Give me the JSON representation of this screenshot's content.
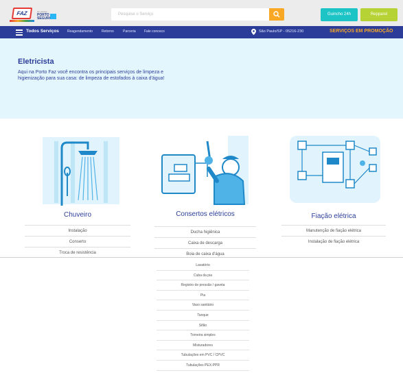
{
  "header": {
    "logo_text": "FAZ",
    "partner_small": "um serviço",
    "partner_name": "PORTO SEGURO",
    "search_placeholder": "Pesquise o Serviço",
    "btn_quincho": "Guincho 24h",
    "btn_rappel": "Repparel"
  },
  "nav": {
    "all_services": "Todos Serviços",
    "links": [
      "Reagendamento",
      "Retorno",
      "Parceria",
      "Fale conosco"
    ],
    "location": "São Paulo/SP - 05216-230",
    "promo": "SERVIÇOS EM PROMOÇÃO"
  },
  "hero": {
    "title": "Eletricista",
    "description": "Aqui na Porto Faz você encontra os principais serviços de limpeza e higienização para sua casa: de limpeza de estofados à caixa d'água!"
  },
  "categories": [
    {
      "title": "Chuveiro",
      "items": [
        "Instalação",
        "Conserto",
        "Troca de resistência"
      ]
    },
    {
      "title": "Consertos elétricos",
      "items": [
        "Ducha higiênica",
        "Caixa de descarga",
        "Boia de caixa d'água"
      ]
    },
    {
      "title": "Fiação elétrica",
      "items": [
        "Manutenção de fiação elétrica",
        "Instalação de fiação elétrica"
      ]
    }
  ],
  "dropdown_items": [
    "Lavatório",
    "Cuba da pia",
    "Registro de pressão / gaveta",
    "Pia",
    "Vaso sanitário",
    "Tanque",
    "Sifão",
    "Torneira simples",
    "Misturadores",
    "Tubulações em PVC / CPVC",
    "Tubulações PEX-PPR"
  ],
  "colors": {
    "primary": "#2b3d99",
    "accent": "#f9a825",
    "cyan": "#1cc4c6",
    "green": "#b5d334",
    "hero_bg": "#e4f6fd"
  }
}
